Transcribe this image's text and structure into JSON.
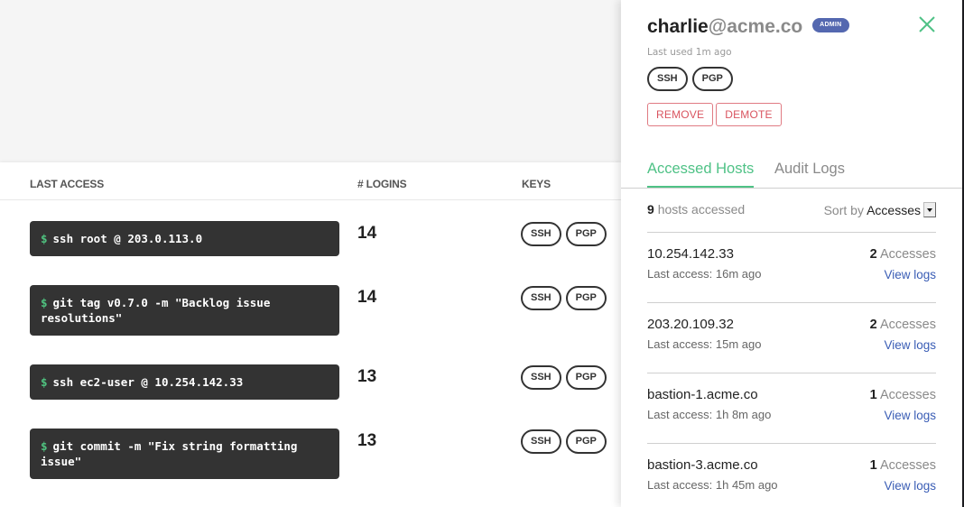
{
  "table": {
    "headers": {
      "last_access": "LAST ACCESS",
      "logins": "# LOGINS",
      "keys": "KEYS"
    },
    "rows": [
      {
        "prompt": "$",
        "command": "ssh root @ 203.0.113.0",
        "logins": "14",
        "keys": [
          "SSH",
          "PGP"
        ]
      },
      {
        "prompt": "$",
        "command": "git tag v0.7.0 -m \"Backlog issue resolutions\"",
        "logins": "14",
        "keys": [
          "SSH",
          "PGP"
        ]
      },
      {
        "prompt": "$",
        "command": "ssh ec2-user @ 10.254.142.33",
        "logins": "13",
        "keys": [
          "SSH",
          "PGP"
        ]
      },
      {
        "prompt": "$",
        "command": "git commit -m \"Fix string formatting issue\"",
        "logins": "13",
        "keys": [
          "SSH",
          "PGP"
        ]
      }
    ]
  },
  "panel": {
    "user_name": "charlie",
    "user_domain": "@acme.co",
    "role_badge": "ADMIN",
    "last_used": "Last used 1m ago",
    "keys": [
      "SSH",
      "PGP"
    ],
    "actions": {
      "remove": "REMOVE",
      "demote": "DEMOTE"
    },
    "tabs": [
      {
        "label": "Accessed Hosts",
        "active": true
      },
      {
        "label": "Audit Logs",
        "active": false
      }
    ],
    "summary": {
      "count": "9",
      "label": "hosts accessed",
      "sort_prefix": "Sort by",
      "sort_value": "Accesses"
    },
    "hosts": [
      {
        "name": "10.254.142.33",
        "last_access": "Last access: 16m ago",
        "accesses": "2",
        "accesses_label": "Accesses",
        "view_logs": "View logs"
      },
      {
        "name": "203.20.109.32",
        "last_access": "Last access: 15m ago",
        "accesses": "2",
        "accesses_label": "Accesses",
        "view_logs": "View logs"
      },
      {
        "name": "bastion-1.acme.co",
        "last_access": "Last access: 1h 8m ago",
        "accesses": "1",
        "accesses_label": "Accesses",
        "view_logs": "View logs"
      },
      {
        "name": "bastion-3.acme.co",
        "last_access": "Last access: 1h 45m ago",
        "accesses": "1",
        "accesses_label": "Accesses",
        "view_logs": "View logs"
      }
    ]
  },
  "colors": {
    "accent_green": "#4fc286",
    "danger": "#d9545f",
    "admin_badge": "#5468b0",
    "link": "#3a5db5",
    "terminal_bg": "#333333"
  }
}
